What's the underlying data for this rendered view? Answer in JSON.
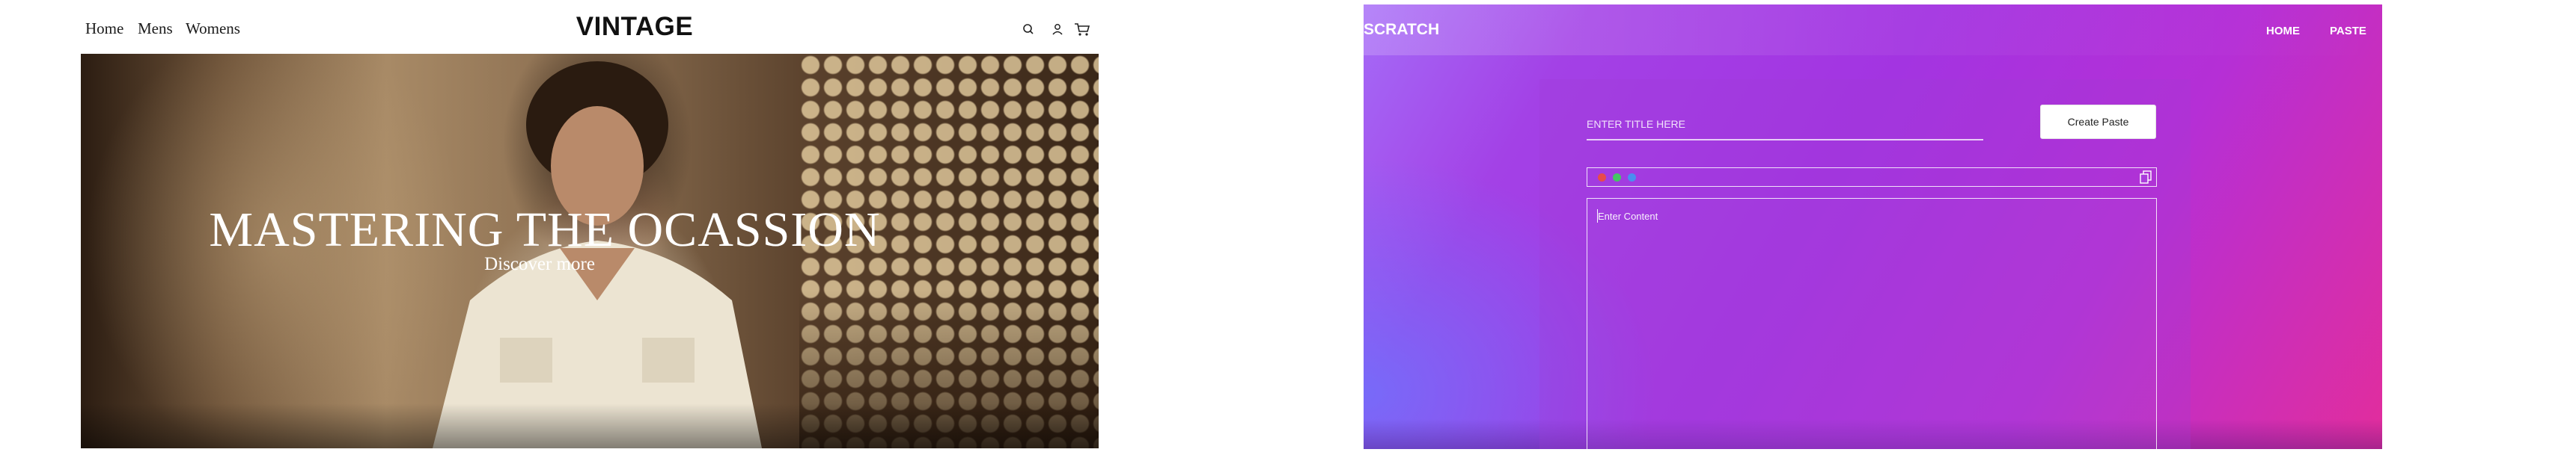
{
  "vintage": {
    "nav": {
      "links": [
        "Home",
        "Mens",
        "Womens"
      ],
      "logo": "VINTAGE",
      "icons": [
        "search-icon",
        "account-icon",
        "cart-icon"
      ]
    },
    "hero": {
      "title": "MASTERING THE OCASSION",
      "cta": "Discover more"
    }
  },
  "scratch": {
    "brand": "SCRATCH",
    "nav": [
      "HOME",
      "PASTE"
    ],
    "title_placeholder": "ENTER TITLE HERE",
    "create_button": "Create Paste",
    "toolbar_dots": [
      "#e84a4a",
      "#44c565",
      "#4a8ef0"
    ],
    "content_placeholder": "Enter Content",
    "copy_icon": "copy-icon"
  },
  "colors": {
    "scratch_gradient_start": "#a56bf7",
    "scratch_gradient_mid": "#a334e1",
    "scratch_gradient_end": "#e22d9c"
  }
}
